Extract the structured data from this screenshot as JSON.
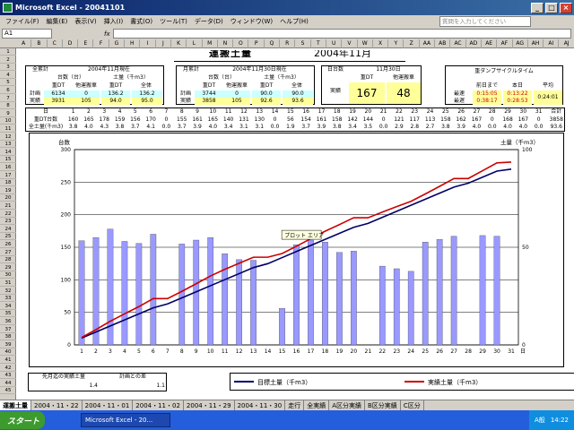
{
  "window": {
    "title": "Microsoft Excel - 20041101",
    "min": "_",
    "max": "□",
    "close": "×"
  },
  "menu": [
    "ファイル(F)",
    "編集(E)",
    "表示(V)",
    "挿入(I)",
    "書式(O)",
    "ツール(T)",
    "データ(D)",
    "ウィンドウ(W)",
    "ヘルプ(H)"
  ],
  "help_placeholder": "質問を入力してください",
  "namebox": "A1",
  "fx": "fx",
  "columns": [
    "A",
    "B",
    "C",
    "D",
    "E",
    "F",
    "G",
    "H",
    "I",
    "J",
    "K",
    "L",
    "M",
    "N",
    "O",
    "P",
    "Q",
    "R",
    "S",
    "T",
    "U",
    "V",
    "W",
    "X",
    "Y",
    "Z",
    "AA",
    "AB",
    "AC",
    "AD",
    "AE",
    "AF",
    "AG",
    "AH",
    "AI",
    "AJ"
  ],
  "rows": [
    "1",
    "2",
    "3",
    "4",
    "5",
    "6",
    "7",
    "8",
    "9",
    "10",
    "11",
    "12",
    "13",
    "14",
    "15",
    "16",
    "17",
    "18",
    "19",
    "20",
    "21",
    "22",
    "23",
    "24",
    "25",
    "26",
    "27",
    "28",
    "29",
    "30",
    "31",
    "32",
    "33",
    "34",
    "35",
    "36",
    "37",
    "38",
    "39",
    "40",
    "41",
    "42",
    "43",
    "44",
    "45"
  ],
  "sheet": {
    "title": "運搬土量",
    "month": "2004年11月",
    "total": {
      "hdr": "全累計",
      "period": "2004年11月現在",
      "c1": "台数（台）",
      "c2": "土量（千m3）",
      "sub": [
        "重DT",
        "他運搬車",
        "重DT",
        "全体"
      ],
      "rows": [
        {
          "label": "計画",
          "vals": [
            "6134",
            "0",
            "136.2",
            "136.2"
          ]
        },
        {
          "label": "実績",
          "vals": [
            "3931",
            "105",
            "94.0",
            "95.0"
          ]
        }
      ]
    },
    "monthly": {
      "hdr": "月累計",
      "period": "2004年11月30日現在",
      "c1": "台数（台）",
      "c2": "土量（千m3）",
      "sub": [
        "重DT",
        "他運搬車",
        "重DT",
        "全体"
      ],
      "rows": [
        {
          "label": "計画",
          "vals": [
            "3744",
            "0",
            "90.0",
            "90.0"
          ]
        },
        {
          "label": "実績",
          "vals": [
            "3858",
            "105",
            "92.6",
            "93.6"
          ]
        }
      ]
    },
    "daily": {
      "hdr": "日台数",
      "date": "11月30日",
      "sub": [
        "重DT",
        "他運搬車"
      ],
      "label": "実績",
      "vals": [
        "167",
        "48"
      ]
    },
    "cycle": {
      "hdr": "重ダンプサイクルタイム",
      "sub": [
        "前日まで",
        "本日",
        "平均"
      ],
      "rows": [
        {
          "label": "最速",
          "vals": [
            "0:15:05",
            "0:13:22"
          ]
        },
        {
          "label": "最遅",
          "vals": [
            "0:38:17",
            "0:28:53"
          ]
        }
      ],
      "avg": "0:24:01"
    },
    "daterow": {
      "label": "日",
      "days": [
        "1",
        "2",
        "3",
        "4",
        "5",
        "6",
        "7",
        "8",
        "9",
        "10",
        "11",
        "12",
        "13",
        "14",
        "15",
        "16",
        "17",
        "18",
        "19",
        "20",
        "21",
        "22",
        "23",
        "24",
        "25",
        "26",
        "27",
        "28",
        "29",
        "30",
        "31"
      ],
      "sum": "合計"
    },
    "dtrow": {
      "label": "重DT台数",
      "vals": [
        "160",
        "165",
        "178",
        "159",
        "156",
        "170",
        "0",
        "155",
        "161",
        "165",
        "140",
        "131",
        "130",
        "0",
        "56",
        "154",
        "161",
        "158",
        "142",
        "144",
        "0",
        "121",
        "117",
        "113",
        "158",
        "162",
        "167",
        "0",
        "168",
        "167",
        "0"
      ],
      "sum": "3858"
    },
    "soilrow": {
      "label": "全土量(千m3)",
      "vals": [
        "3.8",
        "4.0",
        "4.3",
        "3.8",
        "3.7",
        "4.1",
        "0.0",
        "3.7",
        "3.9",
        "4.0",
        "3.4",
        "3.1",
        "3.1",
        "0.0",
        "1.9",
        "3.7",
        "3.9",
        "3.8",
        "3.4",
        "3.5",
        "0.0",
        "2.9",
        "2.8",
        "2.7",
        "3.8",
        "3.9",
        "4.0",
        "0.0",
        "4.0",
        "4.0",
        "0.0"
      ],
      "sum": "93.6"
    },
    "bottom": {
      "h1": "先月迄の実績土量",
      "h2": "計画との差",
      "v1": "1.4",
      "v2": "1.1"
    }
  },
  "chart_data": {
    "type": "bar",
    "categories": [
      "1",
      "2",
      "3",
      "4",
      "5",
      "6",
      "7",
      "8",
      "9",
      "10",
      "11",
      "12",
      "13",
      "14",
      "15",
      "16",
      "17",
      "18",
      "19",
      "20",
      "21",
      "22",
      "23",
      "24",
      "25",
      "26",
      "27",
      "28",
      "29",
      "30",
      "31"
    ],
    "series": [
      {
        "name": "",
        "values": [
          160,
          165,
          178,
          159,
          156,
          170,
          0,
          155,
          161,
          165,
          140,
          131,
          130,
          0,
          56,
          154,
          161,
          158,
          142,
          144,
          0,
          121,
          117,
          113,
          158,
          162,
          167,
          0,
          168,
          167,
          0
        ],
        "axis": "left",
        "type": "bar"
      },
      {
        "name": "目標土量（千m3）",
        "values": [
          3.5,
          6.6,
          9.7,
          12.8,
          15.9,
          19.0,
          21.0,
          24.1,
          27.2,
          30.3,
          33.4,
          36.5,
          39.6,
          41.6,
          44.7,
          47.8,
          50.9,
          54.0,
          57.1,
          60.2,
          62.2,
          65.3,
          68.4,
          71.5,
          74.6,
          77.7,
          80.8,
          82.8,
          85.9,
          89.0,
          90.0
        ],
        "axis": "right",
        "type": "line",
        "color": "#000066"
      },
      {
        "name": "実績土量（千m3）",
        "values": [
          3.8,
          7.8,
          12.1,
          15.9,
          19.6,
          23.7,
          23.7,
          27.4,
          31.3,
          35.3,
          38.7,
          41.8,
          44.9,
          44.9,
          46.8,
          50.5,
          54.4,
          58.2,
          61.6,
          65.1,
          65.1,
          68.0,
          70.8,
          73.5,
          77.3,
          81.2,
          85.2,
          85.2,
          89.2,
          93.2,
          93.6
        ],
        "axis": "right",
        "type": "line",
        "color": "#cc0000"
      }
    ],
    "ylabel": "台数",
    "y2label": "土量（千m3）",
    "xunit": "日",
    "ylim": [
      0,
      300
    ],
    "y2lim": [
      0,
      100
    ],
    "yticks": [
      0,
      50,
      100,
      150,
      200,
      250,
      300
    ],
    "y2ticks": [
      0,
      50,
      100
    ],
    "annotation": "プロット エリア",
    "bar_color": "#9999ff",
    "grid": true
  },
  "tabs": [
    "運搬土量",
    "2004・11・22",
    "2004・11・01",
    "2004・11・02",
    "2004・11・29",
    "2004・11・30",
    "走行",
    "全実績",
    "A区分実績",
    "B区分実績",
    "C区分"
  ],
  "taskbar": {
    "start": "スタート",
    "item": "Microsoft Excel - 20...",
    "time": "14:22",
    "ime": "A般"
  }
}
